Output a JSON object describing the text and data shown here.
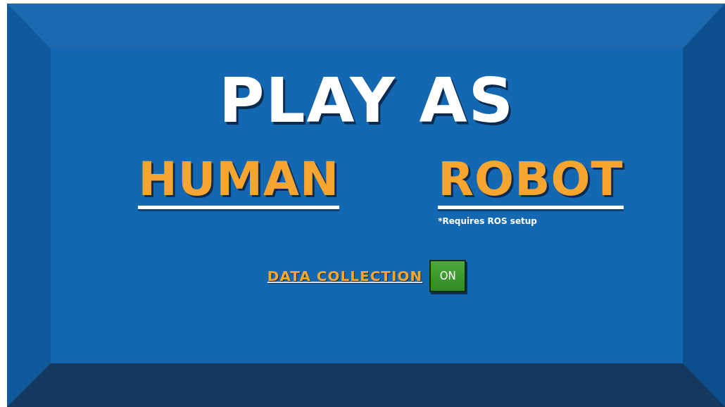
{
  "title": "PLAY AS",
  "options": [
    {
      "label": "HUMAN"
    },
    {
      "label": "ROBOT",
      "note": "*Requires ROS setup"
    }
  ],
  "data_collection": {
    "label": "DATA COLLECTION",
    "on": true,
    "state_text": "ON"
  }
}
